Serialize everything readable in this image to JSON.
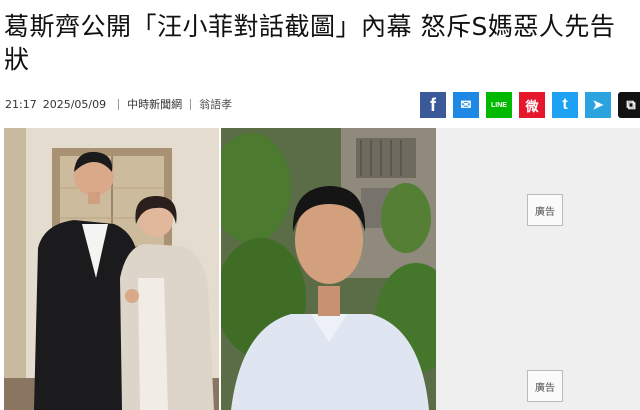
{
  "article": {
    "title": "葛斯齊公開「汪小菲對話截圖」內幕 怒斥S媽惡人先告狀",
    "time": "21:17",
    "date": "2025/05/09",
    "source": "中時新聞網",
    "author": "翁語孝"
  },
  "share": {
    "buttons": [
      {
        "name": "facebook",
        "glyph": "f",
        "color": "#3b5998"
      },
      {
        "name": "messenger",
        "glyph": "✉",
        "color": "#1e88e5"
      },
      {
        "name": "line",
        "glyph": "LINE",
        "color": "#00b900"
      },
      {
        "name": "weibo",
        "glyph": "微",
        "color": "#e6162d"
      },
      {
        "name": "twitter",
        "glyph": "t",
        "color": "#1da1f2"
      },
      {
        "name": "telegram",
        "glyph": "➤",
        "color": "#2aa3de"
      },
      {
        "name": "copy",
        "glyph": "⧉",
        "color": "#111111"
      }
    ]
  },
  "ads": [
    {
      "label": "廣告"
    },
    {
      "label": "廣告"
    }
  ]
}
